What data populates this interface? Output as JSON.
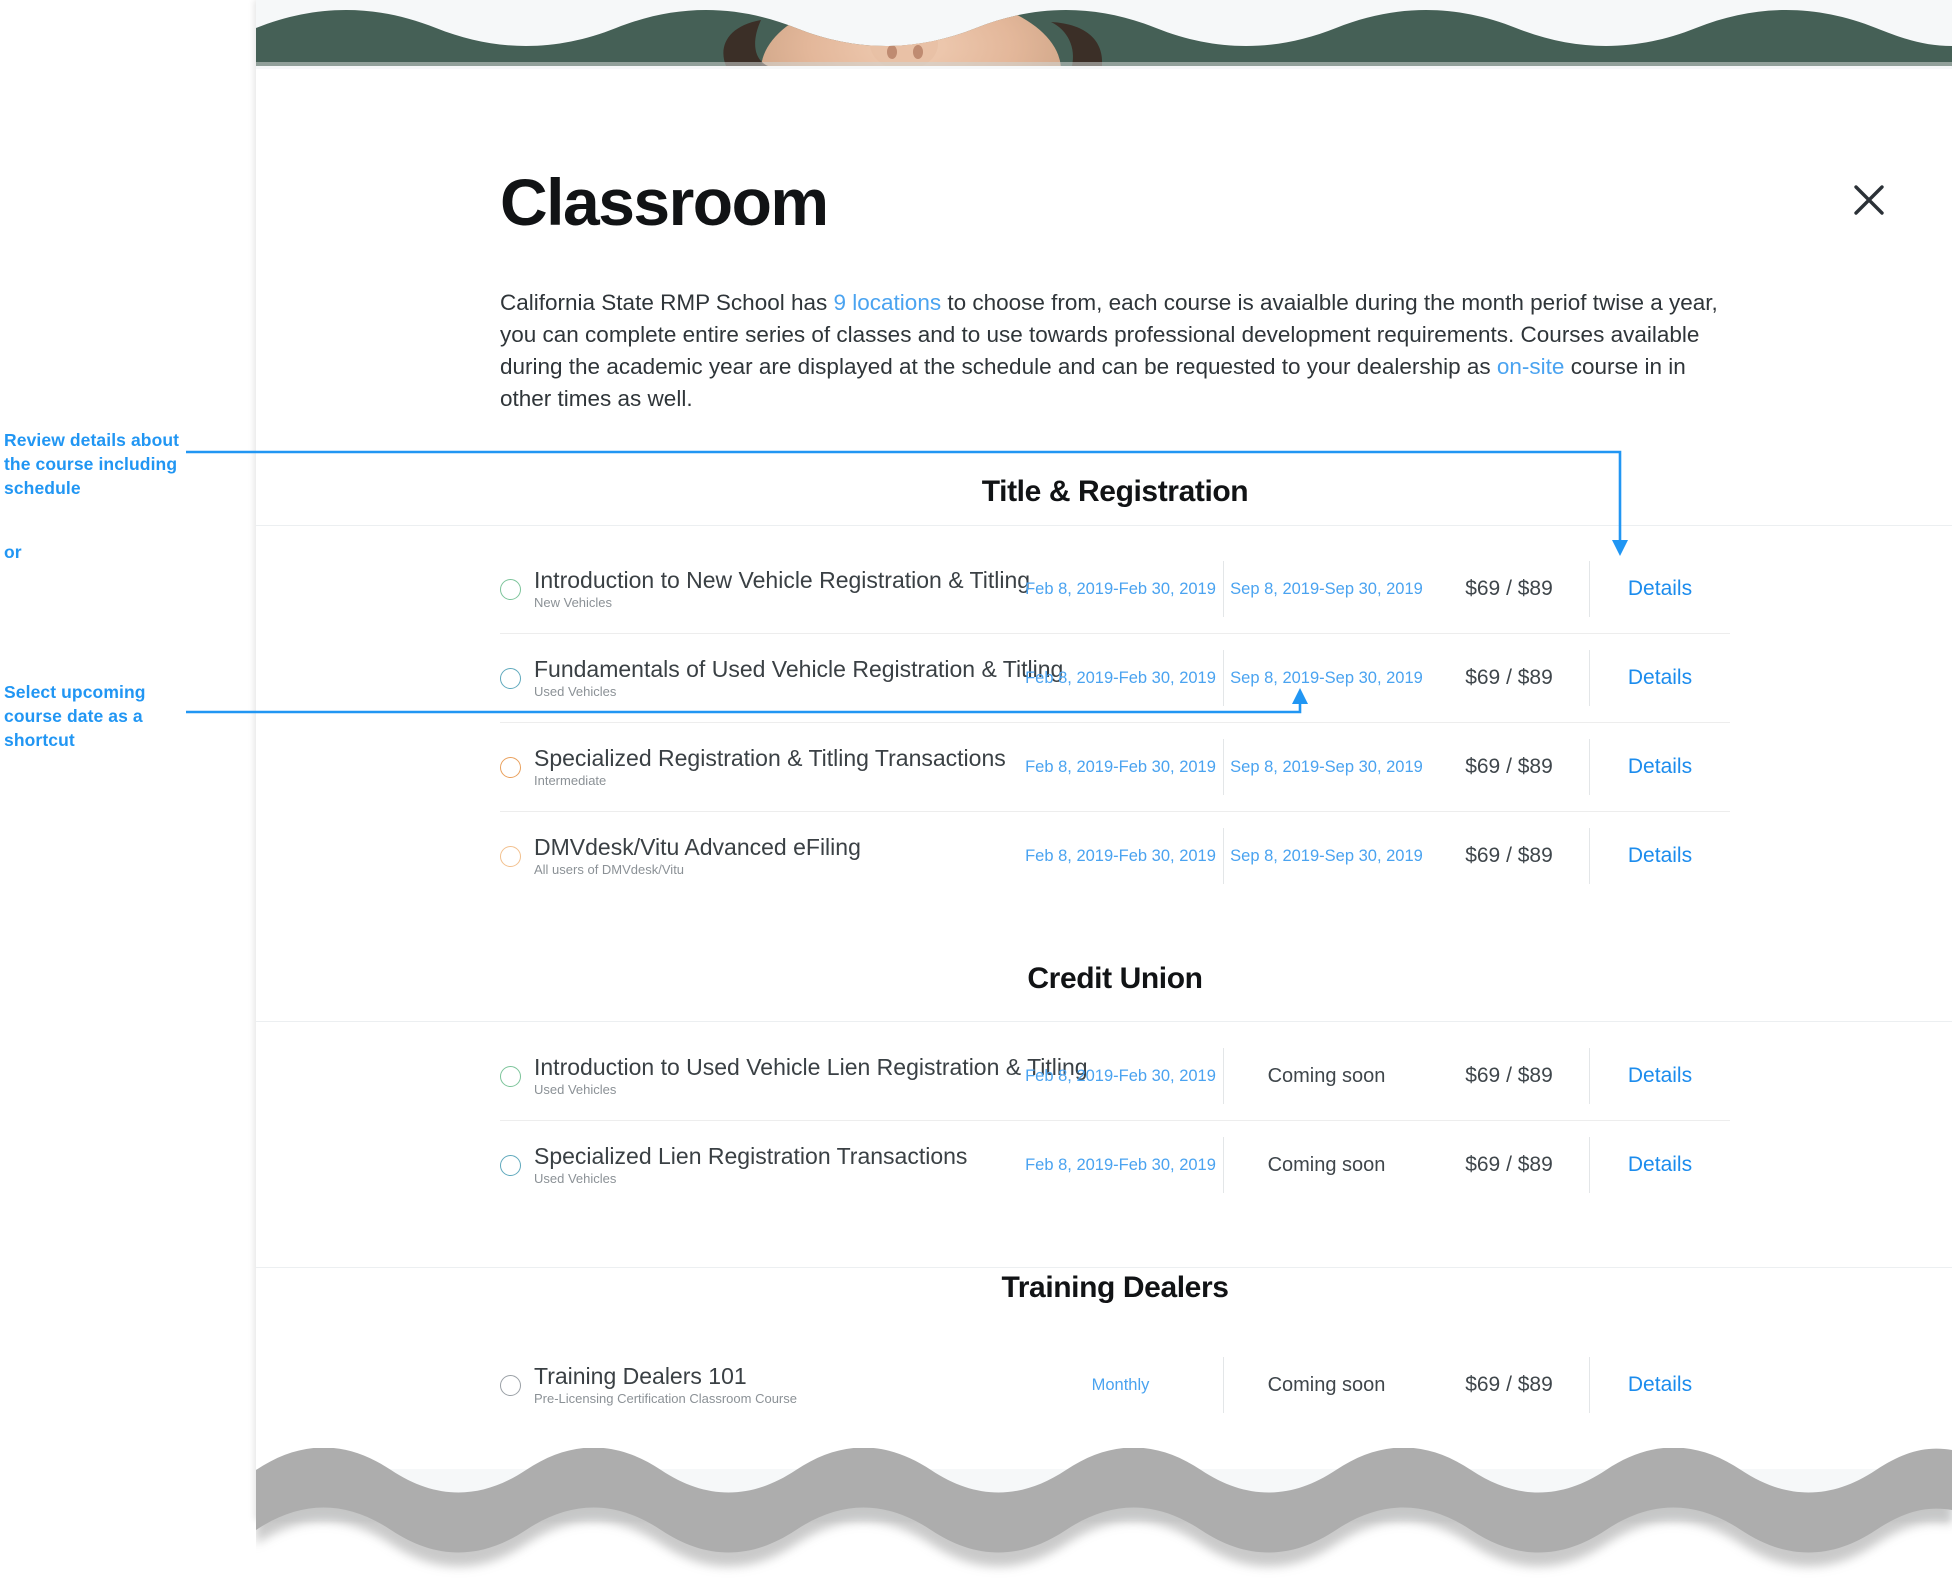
{
  "colors": {
    "accent_blue": "#2196f3",
    "link_blue": "#4aa3f0",
    "details_blue": "#1c8ced",
    "hero_green": "#456056",
    "wave_gray": "#aaaaaa",
    "text_dark": "#111315",
    "text_body": "#2f3539",
    "ring_green": "#7cc49a",
    "ring_teal": "#5fa9bd",
    "ring_orange": "#e9a05c",
    "ring_light_orange": "#f2c08e",
    "ring_gray": "#9aa0a6"
  },
  "header": {
    "title": "Classroom",
    "close_icon": "close-icon",
    "close_label": "✕"
  },
  "intro": {
    "part1": "California State RMP School has ",
    "link1": "9 locations",
    "part2": " to choose from, each course is avaialble during the month periof twise a year, you can complete entire series of classes and to use towards professional development requirements. Courses available during the academic year are displayed at the schedule and can be requested to your dealership as ",
    "link2": "on-site",
    "part3": " course in in other times as well."
  },
  "annotations": {
    "one": "Review details about the course including schedule",
    "or": "or",
    "two": "Select upcoming course date as a shortcut"
  },
  "sections": [
    {
      "title": "Title & Registration",
      "rows": [
        {
          "ring": "ring_green",
          "title": "Introduction to New Vehicle Registration & Titling",
          "sub": "New Vehicles",
          "date1": "Feb 8, 2019-Feb 30, 2019",
          "date2": "Sep 8, 2019-Sep 30, 2019",
          "date2_plain": false,
          "price": "$69 / $89",
          "details": "Details"
        },
        {
          "ring": "ring_teal",
          "title": "Fundamentals of Used Vehicle Registration & Titling",
          "sub": "Used Vehicles",
          "date1": "Feb 8, 2019-Feb 30, 2019",
          "date2": "Sep 8, 2019-Sep 30, 2019",
          "date2_plain": false,
          "price": "$69 / $89",
          "details": "Details"
        },
        {
          "ring": "ring_orange",
          "title": "Specialized Registration & Titling Transactions",
          "sub": "Intermediate",
          "date1": "Feb 8, 2019-Feb 30, 2019",
          "date2": "Sep 8, 2019-Sep 30, 2019",
          "date2_plain": false,
          "price": "$69 / $89",
          "details": "Details"
        },
        {
          "ring": "ring_light_orange",
          "title": "DMVdesk/Vitu Advanced eFiling",
          "sub": "All users of DMVdesk/Vitu",
          "date1": "Feb 8, 2019-Feb 30, 2019",
          "date2": "Sep 8, 2019-Sep 30, 2019",
          "date2_plain": false,
          "price": "$69 / $89",
          "details": "Details"
        }
      ]
    },
    {
      "title": "Credit Union",
      "rows": [
        {
          "ring": "ring_green",
          "title": "Introduction to Used Vehicle Lien Registration & Titling",
          "sub": "Used Vehicles",
          "date1": "Feb 8, 2019-Feb 30, 2019",
          "date2": "Coming soon",
          "date2_plain": true,
          "price": "$69 / $89",
          "details": "Details"
        },
        {
          "ring": "ring_teal",
          "title": "Specialized Lien Registration Transactions",
          "sub": "Used Vehicles",
          "date1": "Feb 8, 2019-Feb 30, 2019",
          "date2": "Coming soon",
          "date2_plain": true,
          "price": "$69 / $89",
          "details": "Details"
        }
      ]
    },
    {
      "title": "Training Dealers",
      "rows": [
        {
          "ring": "ring_gray",
          "title": "Training Dealers 101",
          "sub": "Pre-Licensing Certification Classroom Course",
          "date1": "Monthly",
          "date2": "Coming soon",
          "date2_plain": true,
          "price": "$69 / $89",
          "details": "Details"
        }
      ]
    }
  ]
}
